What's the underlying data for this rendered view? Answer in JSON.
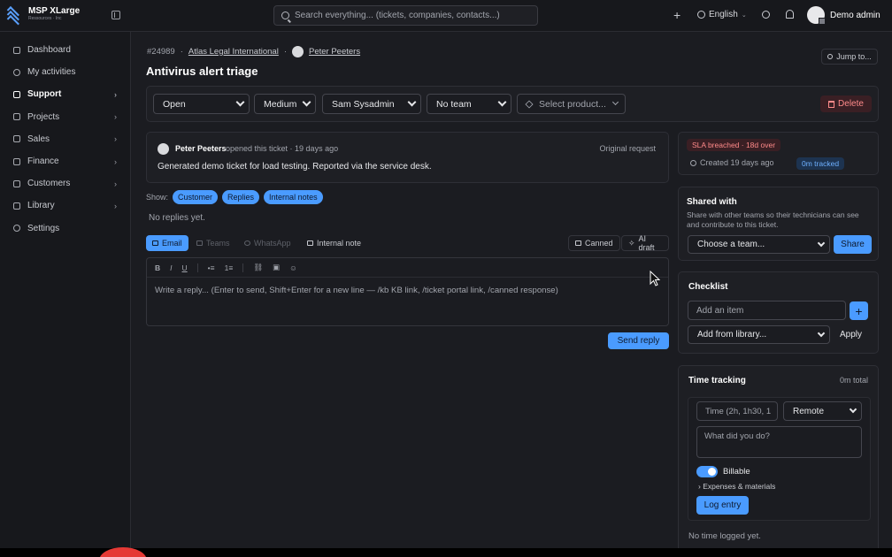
{
  "brand": {
    "name": "MSP XLarge",
    "subtitle": "Ressources · Inc"
  },
  "search": {
    "placeholder": "Search everything... (tickets, companies, contacts...)"
  },
  "topbar": {
    "language": "English",
    "user_name": "Demo admin"
  },
  "sidebar": {
    "items": [
      {
        "label": "Dashboard",
        "icon": "dashboard-icon",
        "has_children": false
      },
      {
        "label": "My activities",
        "icon": "activity-icon",
        "has_children": false
      },
      {
        "label": "Support",
        "icon": "ticket-icon",
        "has_children": true,
        "active": true
      },
      {
        "label": "Projects",
        "icon": "projects-icon",
        "has_children": true
      },
      {
        "label": "Sales",
        "icon": "chart-icon",
        "has_children": true
      },
      {
        "label": "Finance",
        "icon": "document-icon",
        "has_children": true
      },
      {
        "label": "Customers",
        "icon": "building-icon",
        "has_children": true
      },
      {
        "label": "Library",
        "icon": "book-icon",
        "has_children": true
      },
      {
        "label": "Settings",
        "icon": "gear-icon",
        "has_children": false
      }
    ]
  },
  "ticket": {
    "number": "#24989",
    "company": "Atlas Legal International",
    "contact": "Peter Peeters",
    "title": "Antivirus alert triage",
    "jump_label": "Jump to..."
  },
  "filters": {
    "status": "Open",
    "priority": "Medium",
    "assignee": "Sam Sysadmin",
    "team": "No team",
    "product_placeholder": "Select product...",
    "delete_label": "Delete"
  },
  "original_request": {
    "author": "Peter Peeters",
    "meta": "opened this ticket · 19 days ago",
    "tag": "Original request",
    "body": "Generated demo ticket for load testing. Reported via the service desk."
  },
  "show": {
    "label": "Show:",
    "chips": [
      "Customer",
      "Replies",
      "Internal notes"
    ],
    "empty": "No replies yet."
  },
  "channels": {
    "email": "Email",
    "teams": "Teams",
    "whatsapp": "WhatsApp",
    "internal_note": "Internal note",
    "canned": "Canned",
    "ai_draft": "AI draft"
  },
  "editor": {
    "toolbar": [
      "B",
      "I",
      "U",
      "•≡",
      "1≡",
      "⛓",
      "▣",
      "☺"
    ],
    "placeholder": "Write a reply... (Enter to send, Shift+Enter for a new line — /kb KB link, /ticket portal link, /canned response)",
    "send_label": "Send reply"
  },
  "sla": {
    "breached": "SLA breached · 18d over",
    "created": "Created 19 days ago",
    "tracked": "0m tracked"
  },
  "shared": {
    "title": "Shared with",
    "description": "Share with other teams so their technicians can see and contribute to this ticket.",
    "select_placeholder": "Choose a team...",
    "share_label": "Share"
  },
  "checklist": {
    "title": "Checklist",
    "input_placeholder": "Add an item",
    "add_symbol": "+",
    "library_placeholder": "Add from library...",
    "apply_label": "Apply"
  },
  "time_tracking": {
    "title": "Time tracking",
    "total": "0m total",
    "time_placeholder": "Time (2h, 1h30, 1",
    "location": "Remote",
    "description_placeholder": "What did you do?",
    "billable_label": "Billable",
    "billable": true,
    "expenses_label": "Expenses & materials",
    "log_label": "Log entry",
    "empty": "No time logged yet."
  },
  "colors": {
    "accent": "#4a9bff",
    "danger": "#ff8a8a",
    "background": "#1b1c21"
  }
}
